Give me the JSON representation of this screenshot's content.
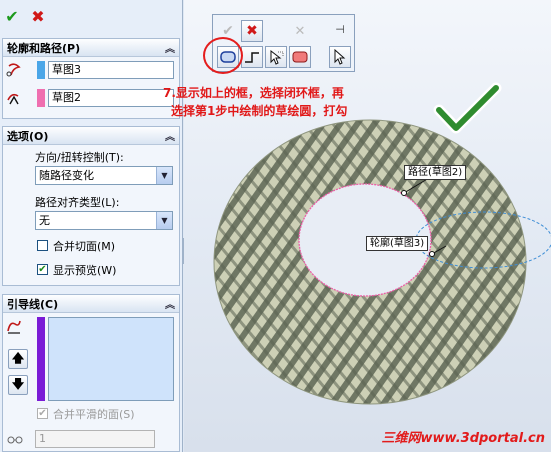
{
  "property_manager": {
    "confirm_icon": "check-icon",
    "cancel_icon": "x-icon",
    "profile_path": {
      "title": "轮廓和路径(P)",
      "profile_value": "草图3",
      "profile_color": "#4aa6e8",
      "path_value": "草图2",
      "path_color": "#ef6fb0"
    },
    "options": {
      "title": "选项(O)",
      "orientation_label": "方向/扭转控制(T):",
      "orientation_value": "随路径变化",
      "path_align_label": "路径对齐类型(L):",
      "path_align_value": "无",
      "merge_faces_label": "合并切面(M)",
      "merge_faces_checked": false,
      "show_preview_label": "显示预览(W)",
      "show_preview_checked": true
    },
    "guide_curves": {
      "title": "引导线(C)",
      "merge_smooth_label": "合并平滑的面(S)",
      "merge_smooth_checked": true,
      "spin_value": "1"
    }
  },
  "viewport": {
    "annotation_line1": "7.显示如上的框，选择闭环框，再",
    "annotation_line2": "选择第1步中绘制的草绘圆，打勾",
    "path_tag": "路径(草图2)",
    "profile_tag": "轮廓(草图3)",
    "watermark": "三维网www.3dportal.cn"
  },
  "colors": {
    "annotation": "#e11818",
    "check_mark": "#2f8c2f",
    "solid_base": "#c8cbb0",
    "solid_stripe": "#6b7360"
  }
}
